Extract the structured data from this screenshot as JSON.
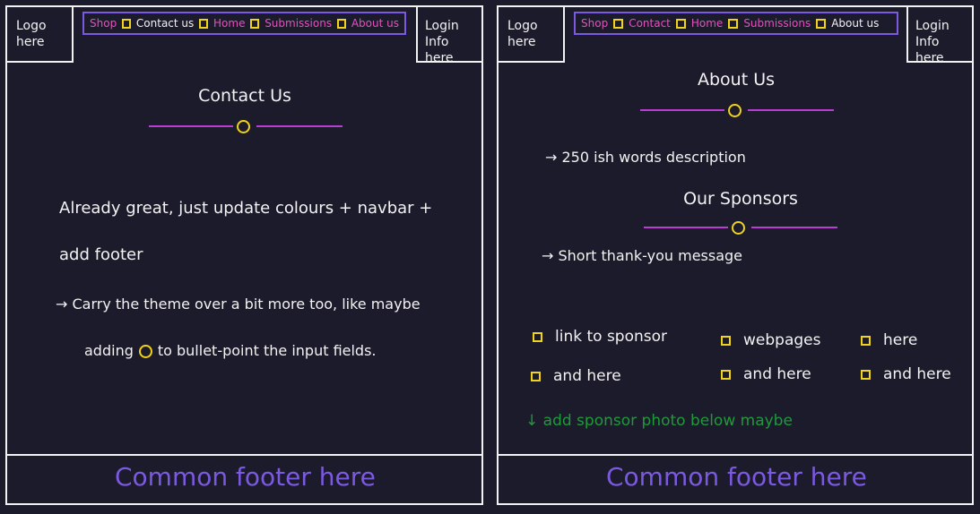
{
  "left": {
    "logo": "Logo\nhere",
    "login": "Login\nInfo here",
    "nav": [
      {
        "label": "Shop",
        "active": false
      },
      {
        "label": "Contact us",
        "active": true
      },
      {
        "label": "Home",
        "active": false
      },
      {
        "label": "Submissions",
        "active": false
      },
      {
        "label": "About us",
        "active": false
      }
    ],
    "title": "Contact Us",
    "line1": "Already great, just update colours + navbar +",
    "line2": "add footer",
    "line3": "→  Carry the theme over a bit more too, like maybe",
    "line4_a": "adding",
    "line4_b": "to bullet-point the input fields.",
    "footer": "Common footer here"
  },
  "right": {
    "logo": "Logo\nhere",
    "login": "Login\nInfo here",
    "nav": [
      {
        "label": "Shop",
        "active": false
      },
      {
        "label": "Contact",
        "active": false
      },
      {
        "label": "Home",
        "active": false
      },
      {
        "label": "Submissions",
        "active": false
      },
      {
        "label": "About us",
        "active": true
      }
    ],
    "title": "About Us",
    "desc": "→  250 ish words description",
    "sponsors_title": "Our Sponsors",
    "thanks": "→  Short thank-you message",
    "links": [
      "link to sponsor",
      "webpages",
      "here",
      "and here",
      "and here",
      "and here"
    ],
    "note": "↓ add sponsor photo below maybe",
    "footer": "Common footer here"
  },
  "colors": {
    "background": "#1c1b2c",
    "ink": "#f2f2f2",
    "nav_pink": "#e84fbf",
    "purple": "#7b59e0",
    "divider": "#b93fd3",
    "yellow": "#f1d21c",
    "note_green": "#1f9a3a"
  }
}
